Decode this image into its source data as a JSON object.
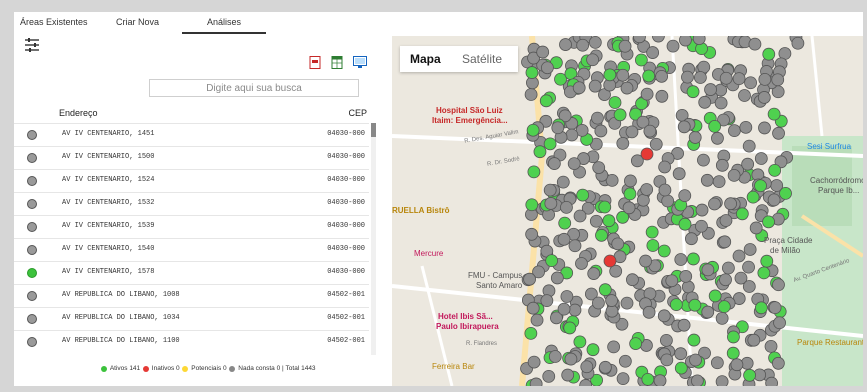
{
  "tabs": [
    {
      "label": "Áreas Existentes"
    },
    {
      "label": "Criar Nova"
    },
    {
      "label": "Análises"
    }
  ],
  "search": {
    "placeholder": "Digite aqui sua busca"
  },
  "table": {
    "headers": {
      "address": "Endereço",
      "cep": "CEP"
    },
    "rows": [
      {
        "address": "AV IV CENTENARIO, 1451",
        "cep": "04030-000",
        "status": "gray"
      },
      {
        "address": "AV IV CENTENARIO, 1500",
        "cep": "04030-000",
        "status": "gray"
      },
      {
        "address": "AV IV CENTENARIO, 1524",
        "cep": "04030-000",
        "status": "gray"
      },
      {
        "address": "AV IV CENTENARIO, 1532",
        "cep": "04030-000",
        "status": "gray"
      },
      {
        "address": "AV IV CENTENARIO, 1539",
        "cep": "04030-000",
        "status": "gray"
      },
      {
        "address": "AV IV CENTENARIO, 1540",
        "cep": "04030-000",
        "status": "gray"
      },
      {
        "address": "AV IV CENTENARIO, 1578",
        "cep": "04030-000",
        "status": "green"
      },
      {
        "address": "AV REPUBLICA DO LIBANO, 1008",
        "cep": "04502-001",
        "status": "gray"
      },
      {
        "address": "AV REPUBLICA DO LIBANO, 1034",
        "cep": "04502-001",
        "status": "gray"
      },
      {
        "address": "AV REPUBLICA DO LIBANO, 1100",
        "cep": "04502-001",
        "status": "gray"
      }
    ]
  },
  "footer": {
    "active": "Ativos 141",
    "inactive": "Inativos 0",
    "potential": "Potenciais 0",
    "none": "Nada consta 0",
    "total": "Total 1443",
    "separator": "|"
  },
  "map": {
    "toggle": {
      "map": "Mapa",
      "satellite": "Satélite"
    },
    "labels": [
      {
        "text": "Hospital São Luiz",
        "color": "#c62828"
      },
      {
        "text": "Itaim: Emergência...",
        "color": "#c62828"
      },
      {
        "text": "R. Des. Aguiar Valim",
        "color": "#777"
      },
      {
        "text": "R. Dr. Sodré",
        "color": "#777"
      },
      {
        "text": "RUELLA Bistrô",
        "color": "#b8860b"
      },
      {
        "text": "Mercure",
        "color": "#c2185b"
      },
      {
        "text": "FMU - Campus",
        "color": "#555"
      },
      {
        "text": "Santo Amaro",
        "color": "#555"
      },
      {
        "text": "Hotel Ibis Sã...",
        "color": "#c2185b"
      },
      {
        "text": "Paulo Ibirapuera",
        "color": "#c2185b"
      },
      {
        "text": "R. Flandres",
        "color": "#777"
      },
      {
        "text": "Ferreira Bar",
        "color": "#b8860b"
      },
      {
        "text": "Parque Restaurante",
        "color": "#b8860b"
      },
      {
        "text": "Cachorródromo",
        "color": "#555"
      },
      {
        "text": "Parque Ib...",
        "color": "#555"
      },
      {
        "text": "Praça Cidade",
        "color": "#555"
      },
      {
        "text": "de Milão",
        "color": "#555"
      },
      {
        "text": "Av. Quarto Centenário",
        "color": "#777"
      },
      {
        "text": "Sesi Surfrua",
        "color": "#1e88e5"
      }
    ]
  },
  "colors": {
    "active": "#3cc23c",
    "inactive": "#e53935",
    "potential": "#fdd835",
    "none": "#888888",
    "marker_gray": "#8f8f8f",
    "marker_green": "#4fd14f",
    "marker_red": "#e53935"
  },
  "icons": {
    "filter": "sliders-icon",
    "pdf": "pdf-icon",
    "excel": "spreadsheet-icon",
    "monitor": "monitor-icon"
  }
}
